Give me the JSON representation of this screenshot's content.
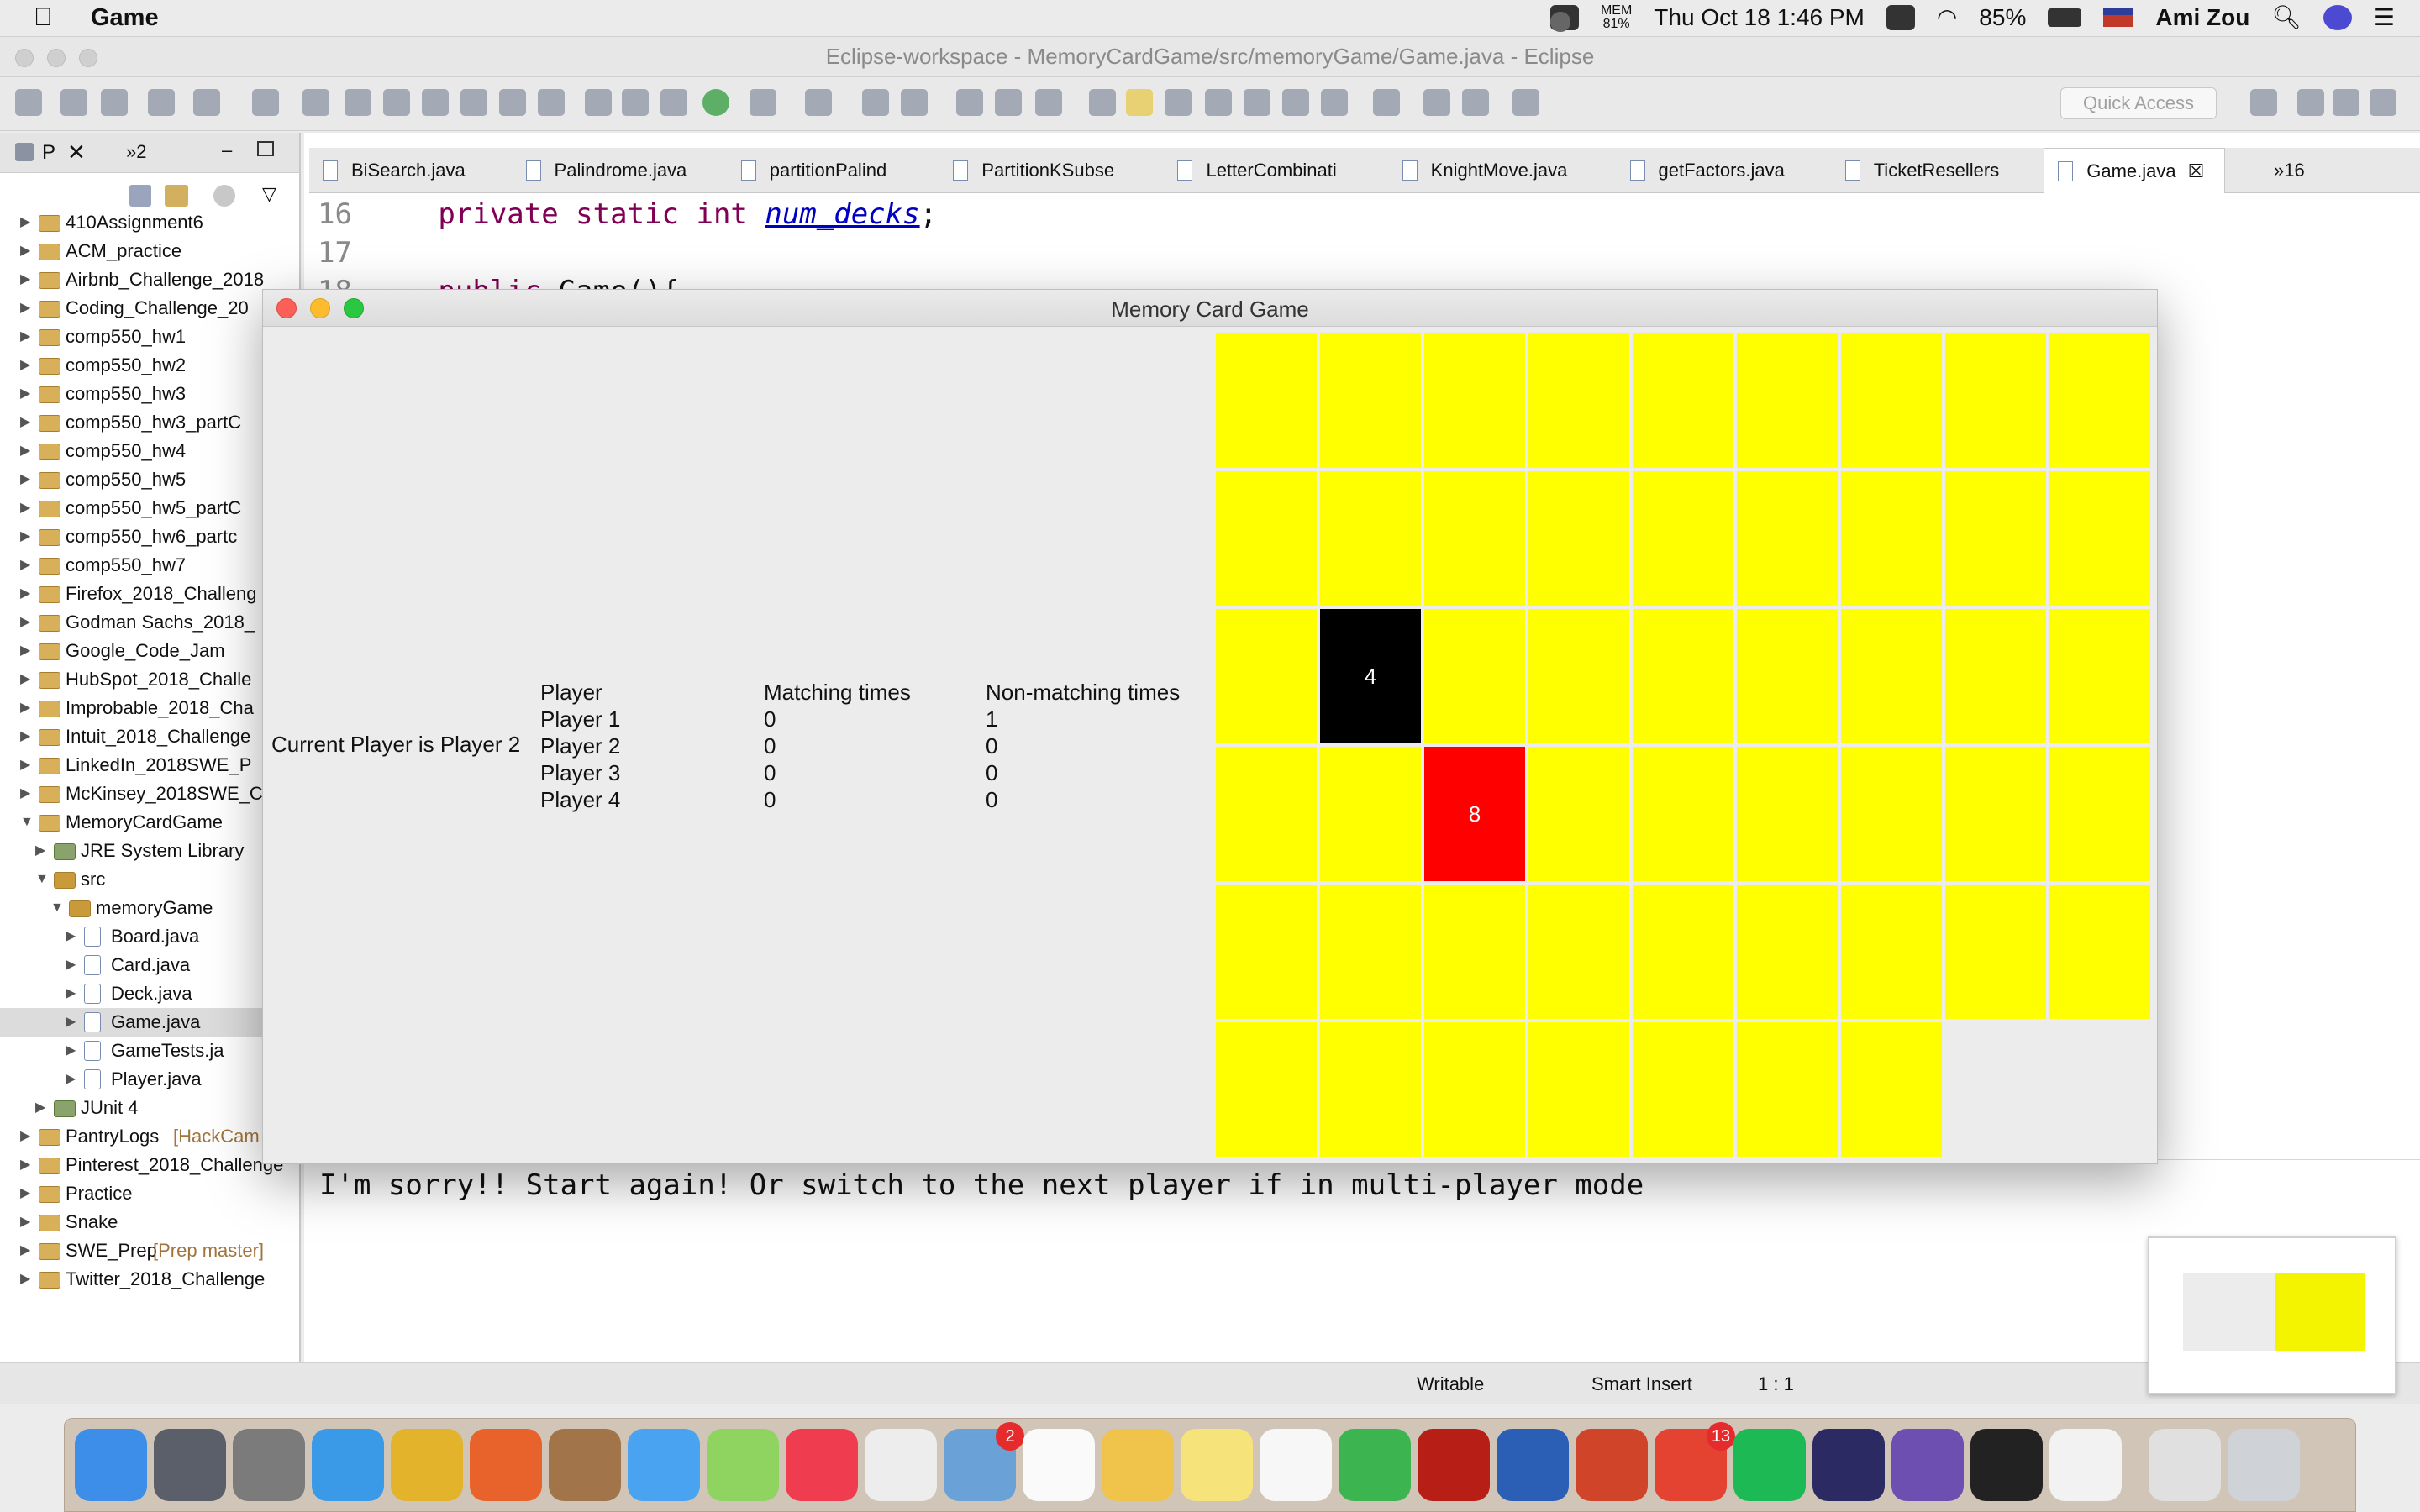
{
  "menubar": {
    "apple": "",
    "app_name": "Game",
    "mem_label": "MEM",
    "mem_value": "81%",
    "datetime": "Thu Oct 18  1:46 PM",
    "battery": "85%",
    "user": "Ami Zou"
  },
  "eclipse": {
    "title": "Eclipse-workspace - MemoryCardGame/src/memoryGame/Game.java - Eclipse",
    "quick_access_placeholder": "Quick Access"
  },
  "package_explorer": {
    "tab_label": "P",
    "overflow_label": "»2",
    "items": [
      {
        "label": "410Assignment6",
        "extra": "",
        "level": 0,
        "expanded": false,
        "type": "project"
      },
      {
        "label": "ACM_practice",
        "extra": "",
        "level": 0,
        "expanded": false,
        "type": "project"
      },
      {
        "label": "Airbnb_Challenge_2018",
        "extra": "",
        "level": 0,
        "expanded": false,
        "type": "project"
      },
      {
        "label": "Coding_Challenge_20",
        "extra": "",
        "level": 0,
        "expanded": false,
        "type": "project"
      },
      {
        "label": "comp550_hw1",
        "extra": "",
        "level": 0,
        "expanded": false,
        "type": "project"
      },
      {
        "label": "comp550_hw2",
        "extra": "",
        "level": 0,
        "expanded": false,
        "type": "project"
      },
      {
        "label": "comp550_hw3",
        "extra": "",
        "level": 0,
        "expanded": false,
        "type": "project"
      },
      {
        "label": "comp550_hw3_partC",
        "extra": "",
        "level": 0,
        "expanded": false,
        "type": "project"
      },
      {
        "label": "comp550_hw4",
        "extra": "",
        "level": 0,
        "expanded": false,
        "type": "project"
      },
      {
        "label": "comp550_hw5",
        "extra": "",
        "level": 0,
        "expanded": false,
        "type": "project"
      },
      {
        "label": "comp550_hw5_partC",
        "extra": "",
        "level": 0,
        "expanded": false,
        "type": "project"
      },
      {
        "label": "comp550_hw6_partc",
        "extra": "",
        "level": 0,
        "expanded": false,
        "type": "project"
      },
      {
        "label": "comp550_hw7",
        "extra": "",
        "level": 0,
        "expanded": false,
        "type": "project"
      },
      {
        "label": "Firefox_2018_Challeng",
        "extra": "",
        "level": 0,
        "expanded": false,
        "type": "project"
      },
      {
        "label": "Godman Sachs_2018_",
        "extra": "",
        "level": 0,
        "expanded": false,
        "type": "project"
      },
      {
        "label": "Google_Code_Jam",
        "extra": "",
        "level": 0,
        "expanded": false,
        "type": "project"
      },
      {
        "label": "HubSpot_2018_Challe",
        "extra": "",
        "level": 0,
        "expanded": false,
        "type": "project"
      },
      {
        "label": "Improbable_2018_Cha",
        "extra": "",
        "level": 0,
        "expanded": false,
        "type": "project"
      },
      {
        "label": "Intuit_2018_Challenge",
        "extra": "",
        "level": 0,
        "expanded": false,
        "type": "project"
      },
      {
        "label": "LinkedIn_2018SWE_P",
        "extra": "",
        "level": 0,
        "expanded": false,
        "type": "project"
      },
      {
        "label": "McKinsey_2018SWE_C",
        "extra": "",
        "level": 0,
        "expanded": false,
        "type": "project"
      },
      {
        "label": "MemoryCardGame",
        "extra": "",
        "level": 0,
        "expanded": true,
        "type": "project"
      },
      {
        "label": "JRE System Library",
        "extra": "",
        "level": 1,
        "expanded": false,
        "type": "lib"
      },
      {
        "label": "src",
        "extra": "",
        "level": 1,
        "expanded": true,
        "type": "pkg"
      },
      {
        "label": "memoryGame",
        "extra": "",
        "level": 2,
        "expanded": true,
        "type": "pkg"
      },
      {
        "label": "Board.java",
        "extra": "",
        "level": 3,
        "expanded": false,
        "type": "java"
      },
      {
        "label": "Card.java",
        "extra": "",
        "level": 3,
        "expanded": false,
        "type": "java"
      },
      {
        "label": "Deck.java",
        "extra": "",
        "level": 3,
        "expanded": false,
        "type": "java"
      },
      {
        "label": "Game.java",
        "extra": "",
        "level": 3,
        "expanded": false,
        "type": "java",
        "selected": true
      },
      {
        "label": "GameTests.ja",
        "extra": "",
        "level": 3,
        "expanded": false,
        "type": "java"
      },
      {
        "label": "Player.java",
        "extra": "",
        "level": 3,
        "expanded": false,
        "type": "java"
      },
      {
        "label": "JUnit 4",
        "extra": "",
        "level": 1,
        "expanded": false,
        "type": "lib"
      },
      {
        "label": "PantryLogs",
        "extra": "[HackCam",
        "level": 0,
        "expanded": false,
        "type": "project"
      },
      {
        "label": "Pinterest_2018_Challenge",
        "extra": "",
        "level": 0,
        "expanded": false,
        "type": "project"
      },
      {
        "label": "Practice",
        "extra": "",
        "level": 0,
        "expanded": false,
        "type": "project"
      },
      {
        "label": "Snake",
        "extra": "",
        "level": 0,
        "expanded": false,
        "type": "project"
      },
      {
        "label": "SWE_Prep",
        "extra": "[Prep master]",
        "level": 0,
        "expanded": false,
        "type": "project"
      },
      {
        "label": "Twitter_2018_Challenge",
        "extra": "",
        "level": 0,
        "expanded": false,
        "type": "project"
      }
    ]
  },
  "editor": {
    "tabs": [
      {
        "label": "BiSearch.java"
      },
      {
        "label": "Palindrome.java"
      },
      {
        "label": "partitionPalind"
      },
      {
        "label": "PartitionKSubse"
      },
      {
        "label": "LetterCombinati"
      },
      {
        "label": "KnightMove.java"
      },
      {
        "label": "getFactors.java"
      },
      {
        "label": "TicketResellers"
      },
      {
        "label": "Game.java",
        "active": true
      }
    ],
    "overflow_label": "»16",
    "code_lines": [
      {
        "num": "16",
        "kw": "private static int ",
        "field": "num_decks",
        "rest": ";"
      },
      {
        "num": "17",
        "kw": "",
        "field": "",
        "rest": ""
      },
      {
        "num": "18",
        "kw": "public ",
        "field": "",
        "rest": "Game(){"
      }
    ]
  },
  "console": {
    "message": "I'm sorry!! Start again! Or switch to the next player if in multi-player mode"
  },
  "statusbar": {
    "writable": "Writable",
    "insert_mode": "Smart Insert",
    "position": "1 : 1"
  },
  "game": {
    "title": "Memory Card Game",
    "current_player": "Current Player is Player 2",
    "score_headers": [
      "Player",
      "Matching times",
      "Non-matching times"
    ],
    "scores": [
      {
        "player": "Player 1",
        "matching": "0",
        "non_matching": "1"
      },
      {
        "player": "Player 2",
        "matching": "0",
        "non_matching": "0"
      },
      {
        "player": "Player 3",
        "matching": "0",
        "non_matching": "0"
      },
      {
        "player": "Player 4",
        "matching": "0",
        "non_matching": "0"
      }
    ],
    "colors": {
      "hidden": "#ffff00",
      "revealed": "#000000",
      "mismatch": "#ff0000"
    },
    "card_rows": [
      [
        {
          "state": "hidden",
          "value": ""
        },
        {
          "state": "hidden",
          "value": ""
        },
        {
          "state": "hidden",
          "value": ""
        },
        {
          "state": "hidden",
          "value": ""
        },
        {
          "state": "hidden",
          "value": ""
        },
        {
          "state": "hidden",
          "value": ""
        },
        {
          "state": "hidden",
          "value": ""
        },
        {
          "state": "hidden",
          "value": ""
        },
        {
          "state": "hidden",
          "value": ""
        }
      ],
      [
        {
          "state": "hidden",
          "value": ""
        },
        {
          "state": "hidden",
          "value": ""
        },
        {
          "state": "hidden",
          "value": ""
        },
        {
          "state": "hidden",
          "value": ""
        },
        {
          "state": "hidden",
          "value": ""
        },
        {
          "state": "hidden",
          "value": ""
        },
        {
          "state": "hidden",
          "value": ""
        },
        {
          "state": "hidden",
          "value": ""
        },
        {
          "state": "hidden",
          "value": ""
        }
      ],
      [
        {
          "state": "hidden",
          "value": ""
        },
        {
          "state": "revealed",
          "value": "4"
        },
        {
          "state": "hidden",
          "value": ""
        },
        {
          "state": "hidden",
          "value": ""
        },
        {
          "state": "hidden",
          "value": ""
        },
        {
          "state": "hidden",
          "value": ""
        },
        {
          "state": "hidden",
          "value": ""
        },
        {
          "state": "hidden",
          "value": ""
        },
        {
          "state": "hidden",
          "value": ""
        }
      ],
      [
        {
          "state": "hidden",
          "value": ""
        },
        {
          "state": "hidden",
          "value": ""
        },
        {
          "state": "mismatch",
          "value": "8"
        },
        {
          "state": "hidden",
          "value": ""
        },
        {
          "state": "hidden",
          "value": ""
        },
        {
          "state": "hidden",
          "value": ""
        },
        {
          "state": "hidden",
          "value": ""
        },
        {
          "state": "hidden",
          "value": ""
        },
        {
          "state": "hidden",
          "value": ""
        }
      ],
      [
        {
          "state": "hidden",
          "value": ""
        },
        {
          "state": "hidden",
          "value": ""
        },
        {
          "state": "hidden",
          "value": ""
        },
        {
          "state": "hidden",
          "value": ""
        },
        {
          "state": "hidden",
          "value": ""
        },
        {
          "state": "hidden",
          "value": ""
        },
        {
          "state": "hidden",
          "value": ""
        },
        {
          "state": "hidden",
          "value": ""
        },
        {
          "state": "hidden",
          "value": ""
        }
      ],
      [
        {
          "state": "hidden",
          "value": ""
        },
        {
          "state": "hidden",
          "value": ""
        },
        {
          "state": "hidden",
          "value": ""
        },
        {
          "state": "hidden",
          "value": ""
        },
        {
          "state": "hidden",
          "value": ""
        },
        {
          "state": "hidden",
          "value": ""
        },
        {
          "state": "hidden",
          "value": ""
        }
      ]
    ]
  },
  "dock": {
    "apps": [
      {
        "name": "finder-icon",
        "color": "#3c8ee8",
        "badge": ""
      },
      {
        "name": "launchpad-icon",
        "color": "#5a5f6a",
        "badge": ""
      },
      {
        "name": "system-preferences-icon",
        "color": "#7b7b7b",
        "badge": ""
      },
      {
        "name": "safari-icon",
        "color": "#3a9ae8",
        "badge": ""
      },
      {
        "name": "chrome-icon",
        "color": "#e4b32c",
        "badge": ""
      },
      {
        "name": "firefox-icon",
        "color": "#e8632c",
        "badge": ""
      },
      {
        "name": "contacts-icon",
        "color": "#a2744a",
        "badge": ""
      },
      {
        "name": "messages-icon",
        "color": "#4aa3f0",
        "badge": ""
      },
      {
        "name": "wechat-icon",
        "color": "#8fd460",
        "badge": ""
      },
      {
        "name": "news-icon",
        "color": "#ef3d4f",
        "badge": ""
      },
      {
        "name": "slack-icon",
        "color": "#ededed",
        "badge": ""
      },
      {
        "name": "mail-icon",
        "color": "#6aa2d8",
        "badge": "2"
      },
      {
        "name": "calendar-icon",
        "color": "#fafafa",
        "badge": ""
      },
      {
        "name": "photos-icon",
        "color": "#f0c44a",
        "badge": ""
      },
      {
        "name": "notes-icon",
        "color": "#f6e37a",
        "badge": ""
      },
      {
        "name": "reminders-icon",
        "color": "#f7f7f7",
        "badge": ""
      },
      {
        "name": "evernote-icon",
        "color": "#3cb551",
        "badge": ""
      },
      {
        "name": "acrobat-icon",
        "color": "#b71f16",
        "badge": ""
      },
      {
        "name": "word-icon",
        "color": "#2b5fb5",
        "badge": ""
      },
      {
        "name": "powerpoint-icon",
        "color": "#d0452a",
        "badge": ""
      },
      {
        "name": "todoist-icon",
        "color": "#e44332",
        "badge": "13"
      },
      {
        "name": "spotify-icon",
        "color": "#1db954",
        "badge": ""
      },
      {
        "name": "eclipse-icon",
        "color": "#2c2a62",
        "badge": ""
      },
      {
        "name": "github-icon",
        "color": "#6c4fb0",
        "badge": ""
      },
      {
        "name": "terminal-icon",
        "color": "#222222",
        "badge": ""
      },
      {
        "name": "java-icon",
        "color": "#f2f2f2",
        "badge": ""
      },
      {
        "name": "documents-icon",
        "color": "#e0e0e0",
        "badge": ""
      },
      {
        "name": "trash-icon",
        "color": "#cfd3d8",
        "badge": ""
      }
    ]
  }
}
